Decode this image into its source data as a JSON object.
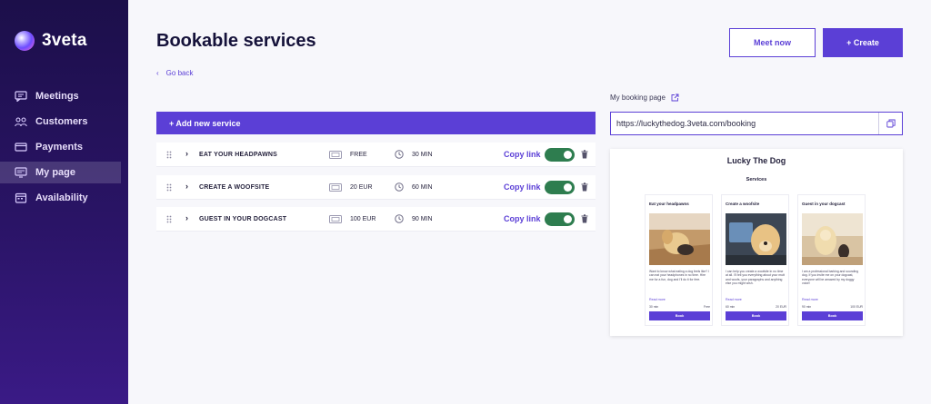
{
  "app": {
    "name": "3veta"
  },
  "sidebar": {
    "items": [
      {
        "label": "Meetings",
        "icon": "chat-icon"
      },
      {
        "label": "Customers",
        "icon": "users-icon"
      },
      {
        "label": "Payments",
        "icon": "card-icon"
      },
      {
        "label": "My page",
        "icon": "monitor-icon",
        "active": true
      },
      {
        "label": "Availability",
        "icon": "calendar-icon"
      }
    ]
  },
  "header": {
    "title": "Bookable services",
    "meet_now_label": "Meet now",
    "create_label": "+ Create",
    "go_back_label": "Go back"
  },
  "services": {
    "add_label": "+ Add new service",
    "copy_link_label": "Copy link",
    "items": [
      {
        "name": "EAT YOUR HEADPAWNS",
        "price": "FREE",
        "duration": "30 MIN",
        "enabled": true
      },
      {
        "name": "CREATE A WOOFSITE",
        "price": "20 EUR",
        "duration": "60 MIN",
        "enabled": true
      },
      {
        "name": "GUEST IN YOUR DOGCAST",
        "price": "100 EUR",
        "duration": "90 MIN",
        "enabled": true
      }
    ]
  },
  "booking": {
    "label": "My booking page",
    "url": "https://luckythedog.3veta.com/booking",
    "preview": {
      "title": "Lucky The Dog",
      "subtitle": "Services",
      "read_more": "Read more",
      "book_label": "Book",
      "cards": [
        {
          "title": "Eat your headpawns",
          "text": "Want to know what eating a dog feels like? I can eat your headphones in no time. Hire me for a fun, dog and I'll do it for free.",
          "duration": "30 min",
          "price": "Free"
        },
        {
          "title": "Create a woofsite",
          "text": "I can help you create a woofsite in no time at all. I'll tell you everything about your mutt and woofs, your paragraphs and anything else you might wish.",
          "duration": "60 min",
          "price": "20 EUR"
        },
        {
          "title": "Guest in your dogcast",
          "text": "I am a professional barking and sounding dog. If you invite me on your dogcast, everyone will be amazed by my doggy voice!",
          "duration": "90 min",
          "price": "100 EUR"
        }
      ]
    }
  },
  "colors": {
    "accent": "#5b3fd6",
    "toggle_on": "#2e7d4f",
    "sidebar_top": "#1c0f4a",
    "sidebar_bottom": "#3a1a86"
  }
}
